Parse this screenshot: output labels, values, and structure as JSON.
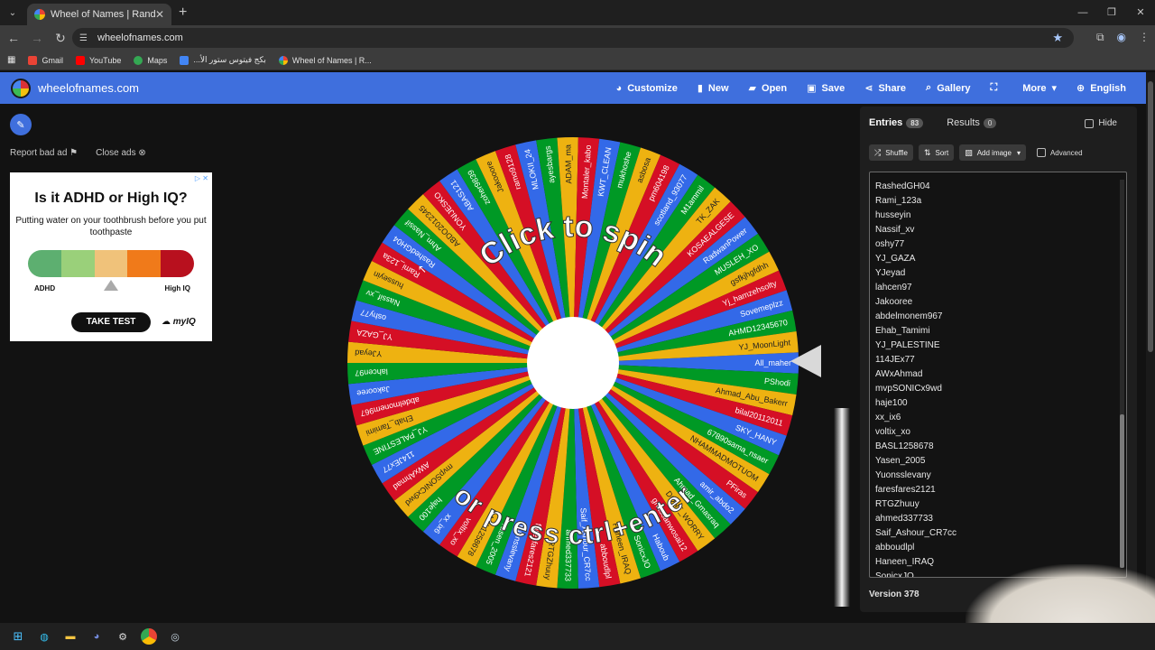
{
  "browser": {
    "tab_title": "Wheel of Names | Random nam",
    "url": "wheelofnames.com",
    "bookmarks": [
      "Gmail",
      "YouTube",
      "Maps",
      "...بكج فيتوس ستور الأ",
      "Wheel of Names | R..."
    ]
  },
  "header": {
    "site_title": "wheelofnames.com",
    "menu": [
      {
        "label": "Customize",
        "icon": "palette-icon"
      },
      {
        "label": "New",
        "icon": "file-icon"
      },
      {
        "label": "Open",
        "icon": "folder-icon"
      },
      {
        "label": "Save",
        "icon": "save-icon"
      },
      {
        "label": "Share",
        "icon": "share-icon"
      },
      {
        "label": "Gallery",
        "icon": "search-icon"
      },
      {
        "label": "",
        "icon": "fullscreen-icon"
      },
      {
        "label": "More",
        "icon": "chevron-down-icon"
      },
      {
        "label": "English",
        "icon": "globe-icon"
      }
    ]
  },
  "ads": {
    "report_label": "Report bad ad",
    "close_label": "Close ads",
    "headline": "Is it ADHD or High IQ?",
    "subtext": "Putting water on your toothbrush before you put toothpaste",
    "left_label": "ADHD",
    "right_label": "High IQ",
    "cta": "TAKE TEST",
    "brand": "myIQ",
    "bar_colors": [
      "#5daf70",
      "#9ad07a",
      "#f0c27a",
      "#f07a1a",
      "#b8101e"
    ]
  },
  "wheel": {
    "top_text": "Click to spin",
    "bottom_text": "or press ctrl+enter",
    "slice_colors": [
      "#3369e8",
      "#009925",
      "#eeb211",
      "#d50f25"
    ],
    "labels": [
      "All_maher",
      "PShodi",
      "Ahmad_Abu_Bakerr",
      "bilal20112011",
      "SKY_HANY",
      "67890sama_nsaer",
      "NHAMMADMOTUOM",
      "PFiras",
      "amir_abdo2",
      "Ahmad_Gmasraq",
      "DONT_WORRY",
      "ghassanwosai12",
      "Haboub",
      "SonicxJO",
      "Haneen_IRAQ",
      "abboudlpl",
      "Saif_Ashour_CR7cc",
      "ahmed337733",
      "RTGZhuuy",
      "faresfares2121",
      "Yuonsslevany",
      "Yasen_2005",
      "BASL1258678",
      "voltix_xo",
      "xx_ix6",
      "haje100",
      "mvpSONICx9wd",
      "AWxAhmad",
      "114JEx77",
      "YJ_PALESTINE",
      "Ehab_Tamimi",
      "abdelmonem967",
      "Jakooree",
      "lahcen97",
      "YJeyad",
      "YJ_GAZA",
      "oshy77",
      "Nassif_xv",
      "husseyin",
      "Rami_123a",
      "RashedGH04",
      "Ahm_Nassif",
      "ABDO2012345",
      "YONIJESKO",
      "ABAS121",
      "zoher9839",
      "Jakooore",
      "ramo9128",
      "MLOKII_24",
      "ayesbargs",
      "ADAM_ma",
      "Montaler_kabo",
      "KWT_CLEAN",
      "mukhoshe",
      "asbosa",
      "pm604198",
      "scotland_93077",
      "M1ammil",
      "TK_ZAK",
      "KOSAEALGESE",
      "RadwanPower",
      "MUSLEH_XO",
      "gsfkjhgfdhh",
      "Yj_hamzehsolty",
      "Sovemeplzz",
      "AHMD12345670",
      "YJ_MoonLight"
    ]
  },
  "panel": {
    "tab_entries": "Entries",
    "entries_count": "83",
    "tab_results": "Results",
    "results_count": "0",
    "hide_label": "Hide",
    "shuffle": "Shuffle",
    "sort": "Sort",
    "add_image": "Add image",
    "advanced": "Advanced",
    "entries": [
      "RashedGH04",
      "Rami_123a",
      "husseyin",
      "Nassif_xv",
      "oshy77",
      "YJ_GAZA",
      "YJeyad",
      "lahcen97",
      "Jakooree",
      "abdelmonem967",
      "Ehab_Tamimi",
      "YJ_PALESTINE",
      "114JEx77",
      "AWxAhmad",
      "mvpSONICx9wd",
      "haje100",
      "xx_ix6",
      "voltix_xo",
      "BASL1258678",
      "Yasen_2005",
      "Yuonsslevany",
      "faresfares2121",
      "RTGZhuuy",
      "ahmed337733",
      "Saif_Ashour_CR7cc",
      "abboudlpl",
      "Haneen_IRAQ",
      "SonicxJO"
    ],
    "version": "Version 378"
  }
}
